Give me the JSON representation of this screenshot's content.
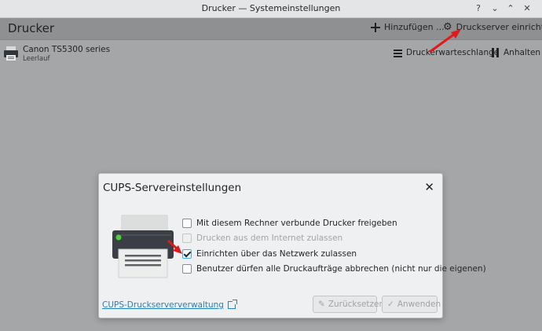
{
  "window": {
    "title": "Drucker — Systemeinstellungen",
    "controls": [
      "?",
      "⌄",
      "⌃",
      "✕"
    ]
  },
  "header": {
    "title": "Drucker",
    "add_label": "Hinzufügen ...",
    "server_label": "Druckserver einrichten ..."
  },
  "printer": {
    "name": "Canon TS5300 series",
    "status": "Leerlauf",
    "queue_label": "Druckerwarteschlange",
    "pause_label": "Anhalten"
  },
  "dialog": {
    "title": "CUPS-Servereinstellungen",
    "options": [
      {
        "label": "Mit diesem Rechner verbunde Drucker freigeben",
        "checked": false,
        "enabled": true
      },
      {
        "label": "Drucken aus dem Internet zulassen",
        "checked": false,
        "enabled": false
      },
      {
        "label": "Einrichten über das Netzwerk zulassen",
        "checked": true,
        "enabled": true
      },
      {
        "label": "Benutzer dürfen alle Druckaufträge abbrechen (nicht nur die eigenen)",
        "checked": false,
        "enabled": true
      }
    ],
    "admin_link": "CUPS-Druckserververwaltung",
    "reset_label": "Zurücksetzen",
    "apply_label": "Anwenden"
  },
  "colors": {
    "accent": "#3daee9",
    "link": "#2980b9",
    "annotation_arrow": "#e0191b",
    "printer_led": "#4cd137"
  }
}
